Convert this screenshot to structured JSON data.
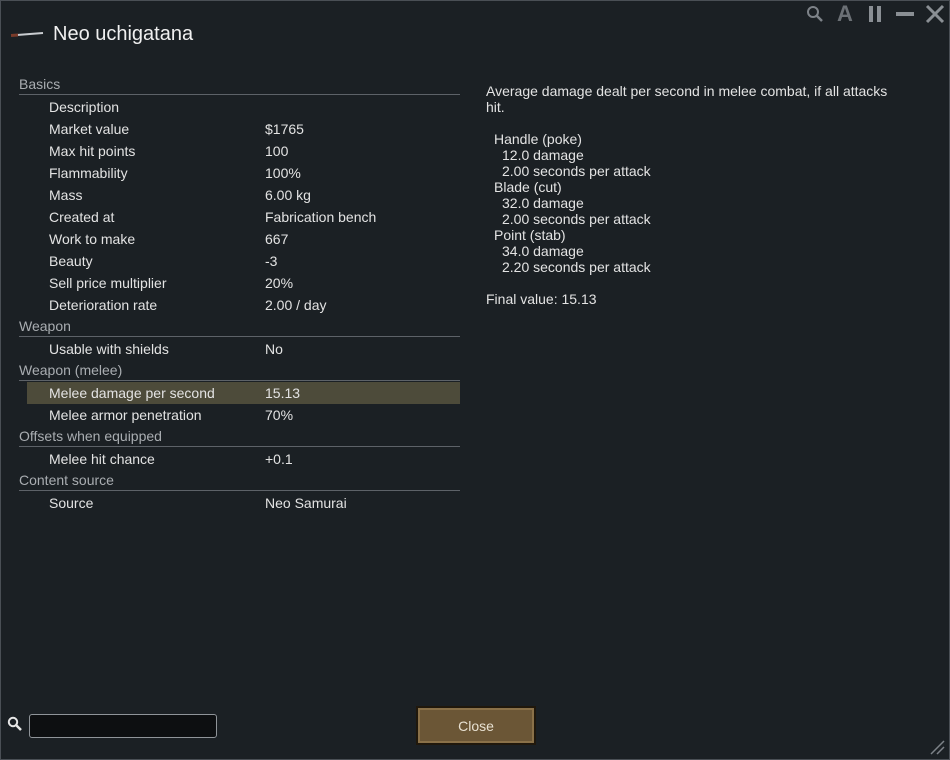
{
  "window": {
    "title": "Neo uchigatana",
    "icon": "katana-icon"
  },
  "top_controls": {
    "icons": [
      "search-icon",
      "font-size-icon",
      "pause-icon",
      "minimize-icon",
      "close-icon"
    ],
    "font_letter": "A"
  },
  "stats": {
    "sections": [
      {
        "title": "Basics",
        "rows": [
          {
            "label": "Description",
            "value": ""
          },
          {
            "label": "Market value",
            "value": "$1765"
          },
          {
            "label": "Max hit points",
            "value": "100"
          },
          {
            "label": "Flammability",
            "value": "100%"
          },
          {
            "label": "Mass",
            "value": "6.00 kg"
          },
          {
            "label": "Created at",
            "value": "Fabrication bench"
          },
          {
            "label": "Work to make",
            "value": "667"
          },
          {
            "label": "Beauty",
            "value": "-3"
          },
          {
            "label": "Sell price multiplier",
            "value": "20%"
          },
          {
            "label": "Deterioration rate",
            "value": "2.00 / day"
          }
        ]
      },
      {
        "title": "Weapon",
        "rows": [
          {
            "label": "Usable with shields",
            "value": "No"
          }
        ]
      },
      {
        "title": "Weapon (melee)",
        "rows": [
          {
            "label": "Melee damage per second",
            "value": "15.13",
            "selected": true
          },
          {
            "label": "Melee armor penetration",
            "value": "70%"
          }
        ]
      },
      {
        "title": "Offsets when equipped",
        "rows": [
          {
            "label": "Melee hit chance",
            "value": "+0.1"
          }
        ]
      },
      {
        "title": "Content source",
        "rows": [
          {
            "label": "Source",
            "value": "Neo Samurai"
          }
        ]
      }
    ]
  },
  "detail": {
    "description": "Average damage dealt per second in melee combat, if all attacks hit.",
    "attacks": [
      {
        "name": "Handle (poke)",
        "damage": "12.0 damage",
        "speed": "2.00 seconds per attack"
      },
      {
        "name": "Blade (cut)",
        "damage": "32.0 damage",
        "speed": "2.00 seconds per attack"
      },
      {
        "name": "Point (stab)",
        "damage": "34.0 damage",
        "speed": "2.20 seconds per attack"
      }
    ],
    "final_value": "Final value: 15.13"
  },
  "footer": {
    "search_value": "",
    "search_icon": "search-icon",
    "close_label": "Close"
  },
  "colors": {
    "background": "#1b2024",
    "selected_row": "#4d4b3a",
    "close_button": "#6b5636"
  }
}
